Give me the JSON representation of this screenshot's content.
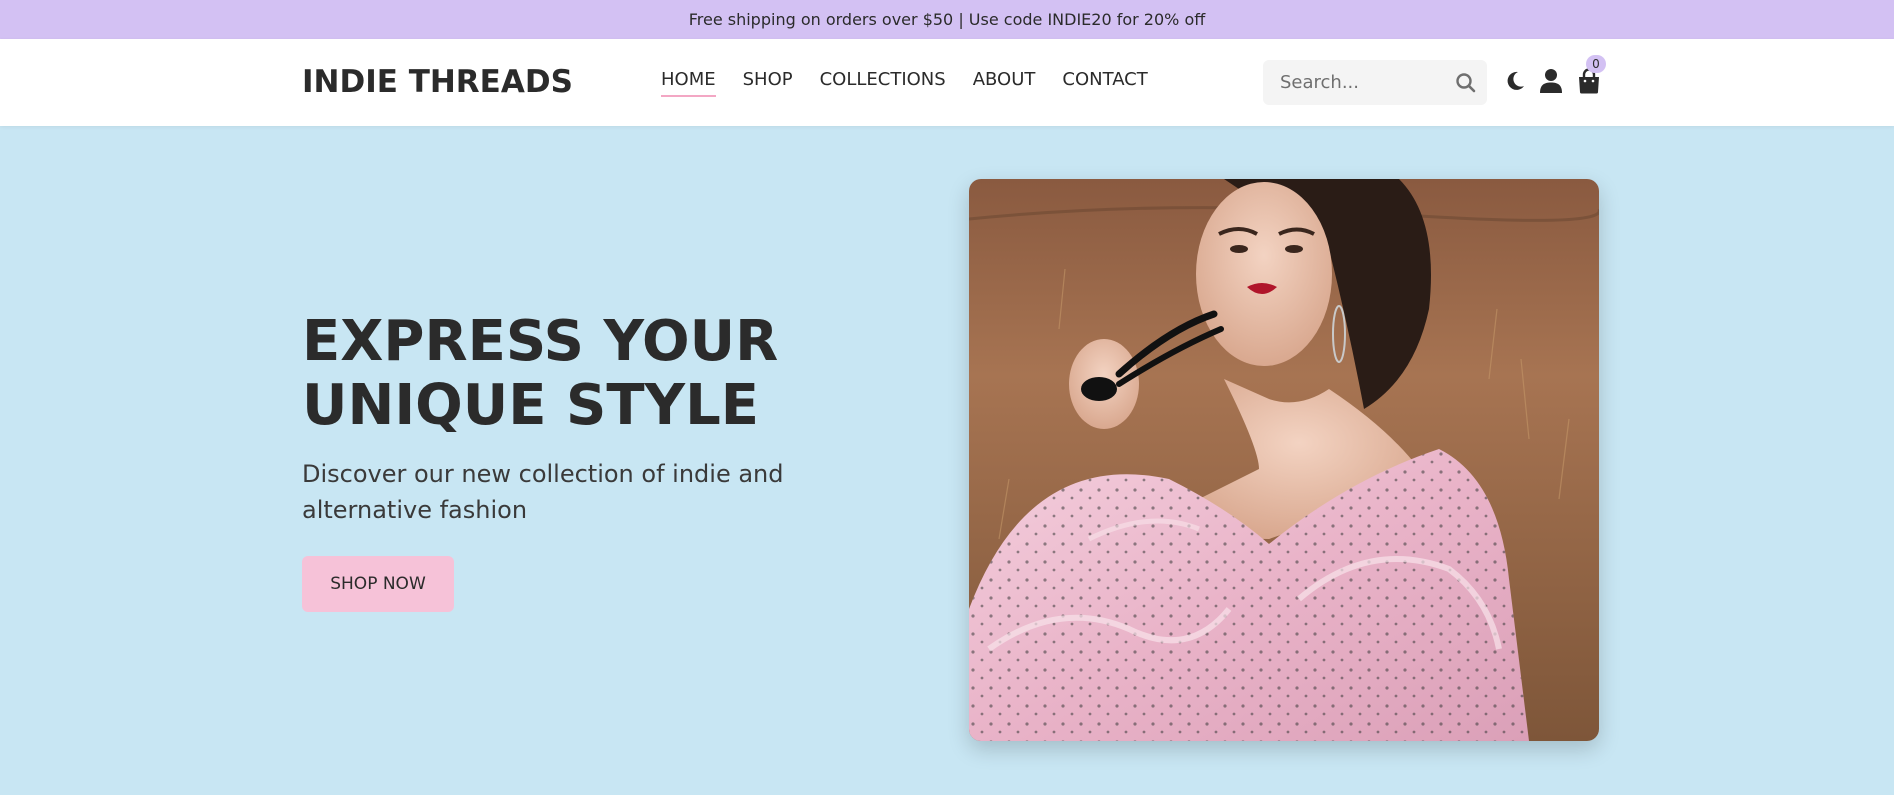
{
  "announcement": {
    "text": "Free shipping on orders over $50 | Use code INDIE20 for 20% off"
  },
  "header": {
    "logo": "INDIE THREADS",
    "nav": [
      {
        "label": "HOME",
        "active": true
      },
      {
        "label": "SHOP",
        "active": false
      },
      {
        "label": "COLLECTIONS",
        "active": false
      },
      {
        "label": "ABOUT",
        "active": false
      },
      {
        "label": "CONTACT",
        "active": false
      }
    ],
    "search": {
      "placeholder": "Search...",
      "value": ""
    },
    "icons": [
      "search-icon",
      "moon-icon",
      "user-icon",
      "shopping-bag-icon"
    ],
    "cart_count": "0"
  },
  "hero": {
    "title": "EXPRESS YOUR UNIQUE STYLE",
    "subtitle": "Discover our new collection of indie and alternative fashion",
    "cta": "SHOP NOW",
    "image_alt": "Model in pink polka-dot tulle dress holding sunglasses in a golden field"
  },
  "colors": {
    "announcement_bg": "#d3c1f3",
    "hero_bg": "#c8e6f3",
    "cta_bg": "#f6c2d8",
    "text": "#2b2b2b",
    "active_underline": "#f3a7c4",
    "badge_bg": "#d3c1f3"
  }
}
